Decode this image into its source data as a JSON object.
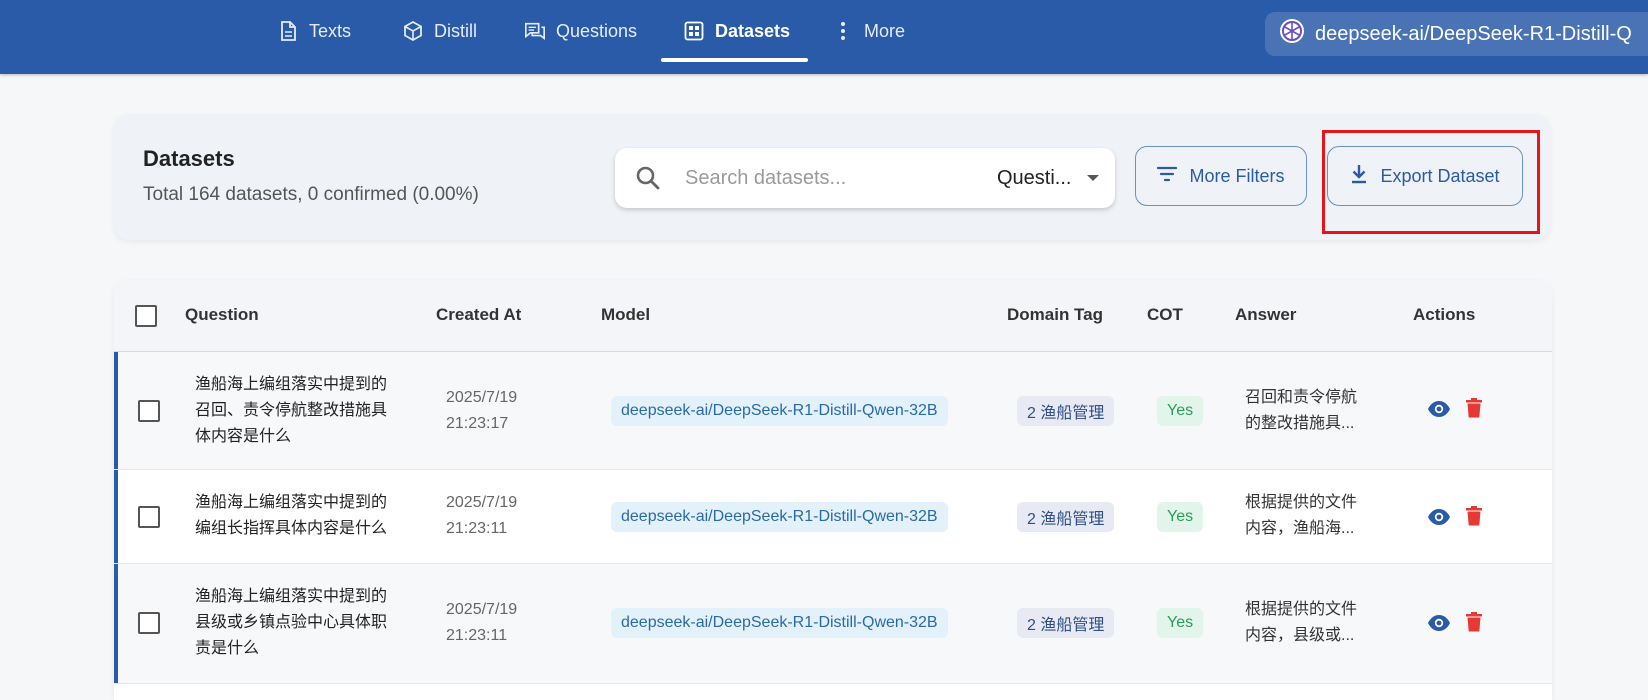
{
  "nav": {
    "tabs": [
      {
        "label": "Texts",
        "icon": "document-icon"
      },
      {
        "label": "Distill",
        "icon": "cube-icon"
      },
      {
        "label": "Questions",
        "icon": "chat-icon"
      },
      {
        "label": "Datasets",
        "icon": "grid-icon",
        "active": true
      },
      {
        "label": "More",
        "icon": "more-vertical-icon"
      }
    ],
    "model_selector": "deepseek-ai/DeepSeek-R1-Distill-Q"
  },
  "filter_card": {
    "title": "Datasets",
    "summary": "Total 164 datasets, 0 confirmed (0.00%)",
    "search": {
      "placeholder": "Search datasets...",
      "field_select": "Questi..."
    },
    "more_filters_label": "More Filters",
    "export_label": "Export Dataset"
  },
  "table": {
    "headers": {
      "question": "Question",
      "created_at": "Created At",
      "model": "Model",
      "domain_tag": "Domain Tag",
      "cot": "COT",
      "answer": "Answer",
      "actions": "Actions"
    },
    "rows": [
      {
        "question_lines": [
          "渔船海上编组落实中提到的",
          "召回、责令停航整改措施具",
          "体内容是什么"
        ],
        "created_date": "2025/7/19",
        "created_time": "21:23:17",
        "model": "deepseek-ai/DeepSeek-R1-Distill-Qwen-32B",
        "domain_tag": "2 渔船管理",
        "cot": "Yes",
        "answer_lines": [
          "召回和责令停航",
          "的整改措施具..."
        ]
      },
      {
        "question_lines": [
          "渔船海上编组落实中提到的",
          "编组长指挥具体内容是什么"
        ],
        "created_date": "2025/7/19",
        "created_time": "21:23:11",
        "model": "deepseek-ai/DeepSeek-R1-Distill-Qwen-32B",
        "domain_tag": "2 渔船管理",
        "cot": "Yes",
        "answer_lines": [
          "根据提供的文件",
          "内容，渔船海..."
        ]
      },
      {
        "question_lines": [
          "渔船海上编组落实中提到的",
          "县级或乡镇点验中心具体职",
          "责是什么"
        ],
        "created_date": "2025/7/19",
        "created_time": "21:23:11",
        "model": "deepseek-ai/DeepSeek-R1-Distill-Qwen-32B",
        "domain_tag": "2 渔船管理",
        "cot": "Yes",
        "answer_lines": [
          "根据提供的文件",
          "内容，县级或..."
        ]
      }
    ]
  },
  "colors": {
    "nav_bg": "#2a5ba8",
    "accent": "#2a5ba8",
    "delete": "#e53935",
    "highlight": "#e8141b",
    "cot_yes": "#2e9a5a"
  }
}
